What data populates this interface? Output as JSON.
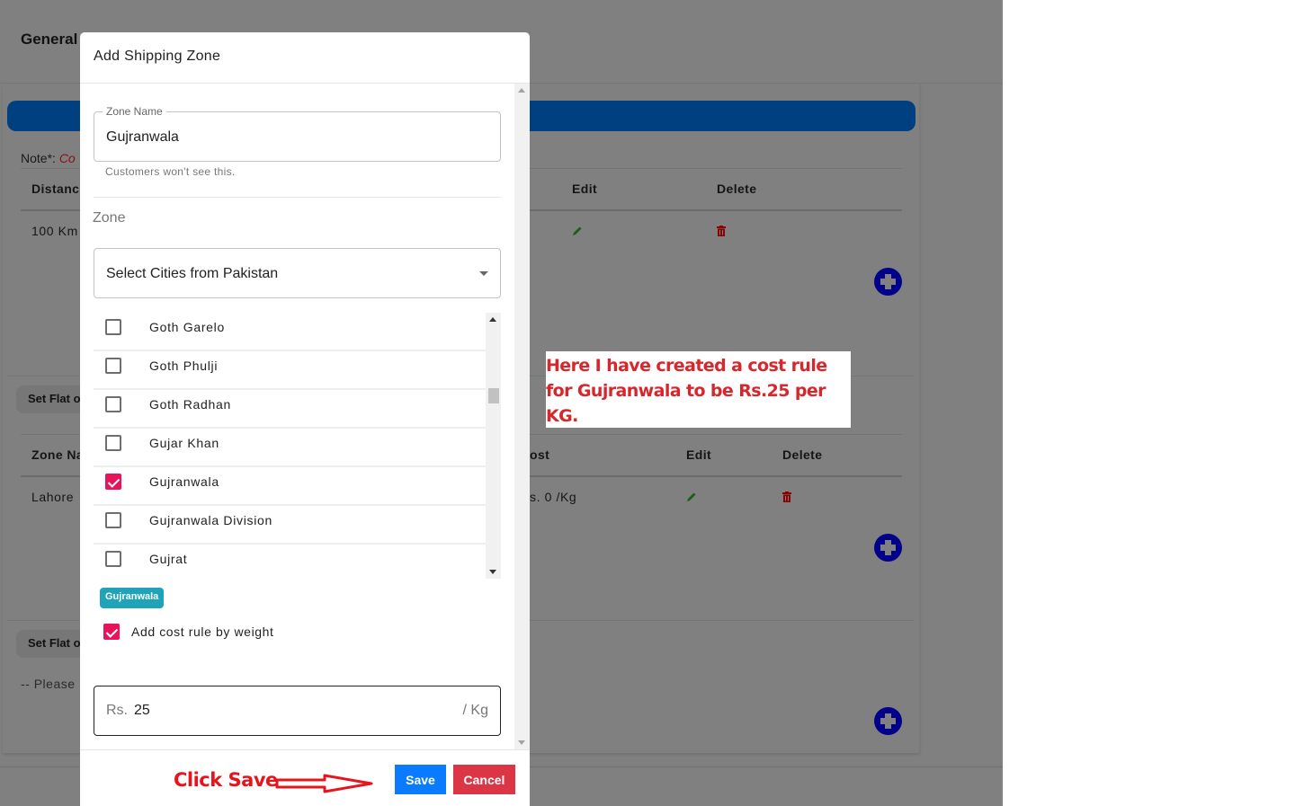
{
  "background": {
    "page_title": "General",
    "note_label": "Note*:",
    "note_text": "Co",
    "distance_table": {
      "headers": [
        "Distance",
        "Edit",
        "Delete"
      ],
      "rows": [
        {
          "distance": "100 Km"
        }
      ]
    },
    "flat_button_1": "Set Flat o",
    "zone_table": {
      "headers": [
        "Zone Na",
        "ost",
        "Edit",
        "Delete"
      ],
      "rows": [
        {
          "zone": "Lahore",
          "cost": "s. 0 /Kg"
        }
      ]
    },
    "flat_button_2": "Set Flat o",
    "please_text": "-- Please ."
  },
  "modal": {
    "title": "Add Shipping Zone",
    "zone_name_label": "Zone Name",
    "zone_name_value": "Gujranwala",
    "zone_name_helper": "Customers won't see this.",
    "zone_section_label": "Zone",
    "city_select_placeholder": "Select Cities from Pakistan",
    "cities": [
      {
        "name": "Goth Garelo",
        "checked": false
      },
      {
        "name": "Goth Phulji",
        "checked": false
      },
      {
        "name": "Goth Radhan",
        "checked": false
      },
      {
        "name": "Gujar Khan",
        "checked": false
      },
      {
        "name": "Gujranwala",
        "checked": true
      },
      {
        "name": "Gujranwala Division",
        "checked": false
      },
      {
        "name": "Gujrat",
        "checked": false
      }
    ],
    "selected_chips": [
      "Gujranwala"
    ],
    "weight_rule_label": "Add cost rule by weight",
    "weight_rule_checked": true,
    "cost_prefix": "Rs.",
    "cost_value": "25",
    "cost_suffix": "/ Kg",
    "save_label": "Save",
    "cancel_label": "Cancel"
  },
  "annotations": {
    "click_save": "Click Save",
    "note": "Here I have created a cost rule for Gujranwala to be Rs.25 per KG."
  },
  "colors": {
    "checkbox_accent": "#e9135c",
    "chip": "#1fa3b8",
    "save": "#0a7bff",
    "cancel": "#dc3545",
    "annotation_red": "#e8141c",
    "header_bar": "#003f80",
    "add_button": "#00008b"
  }
}
